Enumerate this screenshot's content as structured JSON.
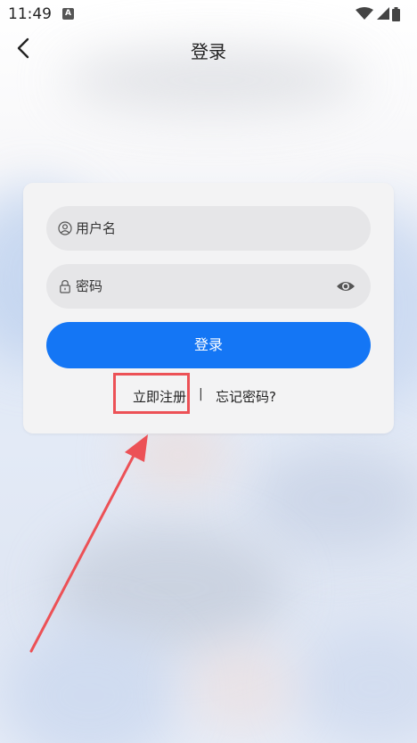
{
  "status_bar": {
    "time": "11:49",
    "notification_badge": "A"
  },
  "header": {
    "title": "登录"
  },
  "form": {
    "username_placeholder": "用户名",
    "password_placeholder": "密码",
    "login_label": "登录",
    "register_label": "立即注册",
    "separator": "|",
    "forgot_label": "忘记密码?"
  },
  "icons": {
    "back": "chevron-left-icon",
    "user": "user-circle-icon",
    "lock": "lock-icon",
    "eye": "eye-icon"
  },
  "colors": {
    "primary": "#1476f5",
    "annotation": "#ec5156",
    "field_bg": "#e6e6e8",
    "card_bg": "#f3f3f4"
  }
}
